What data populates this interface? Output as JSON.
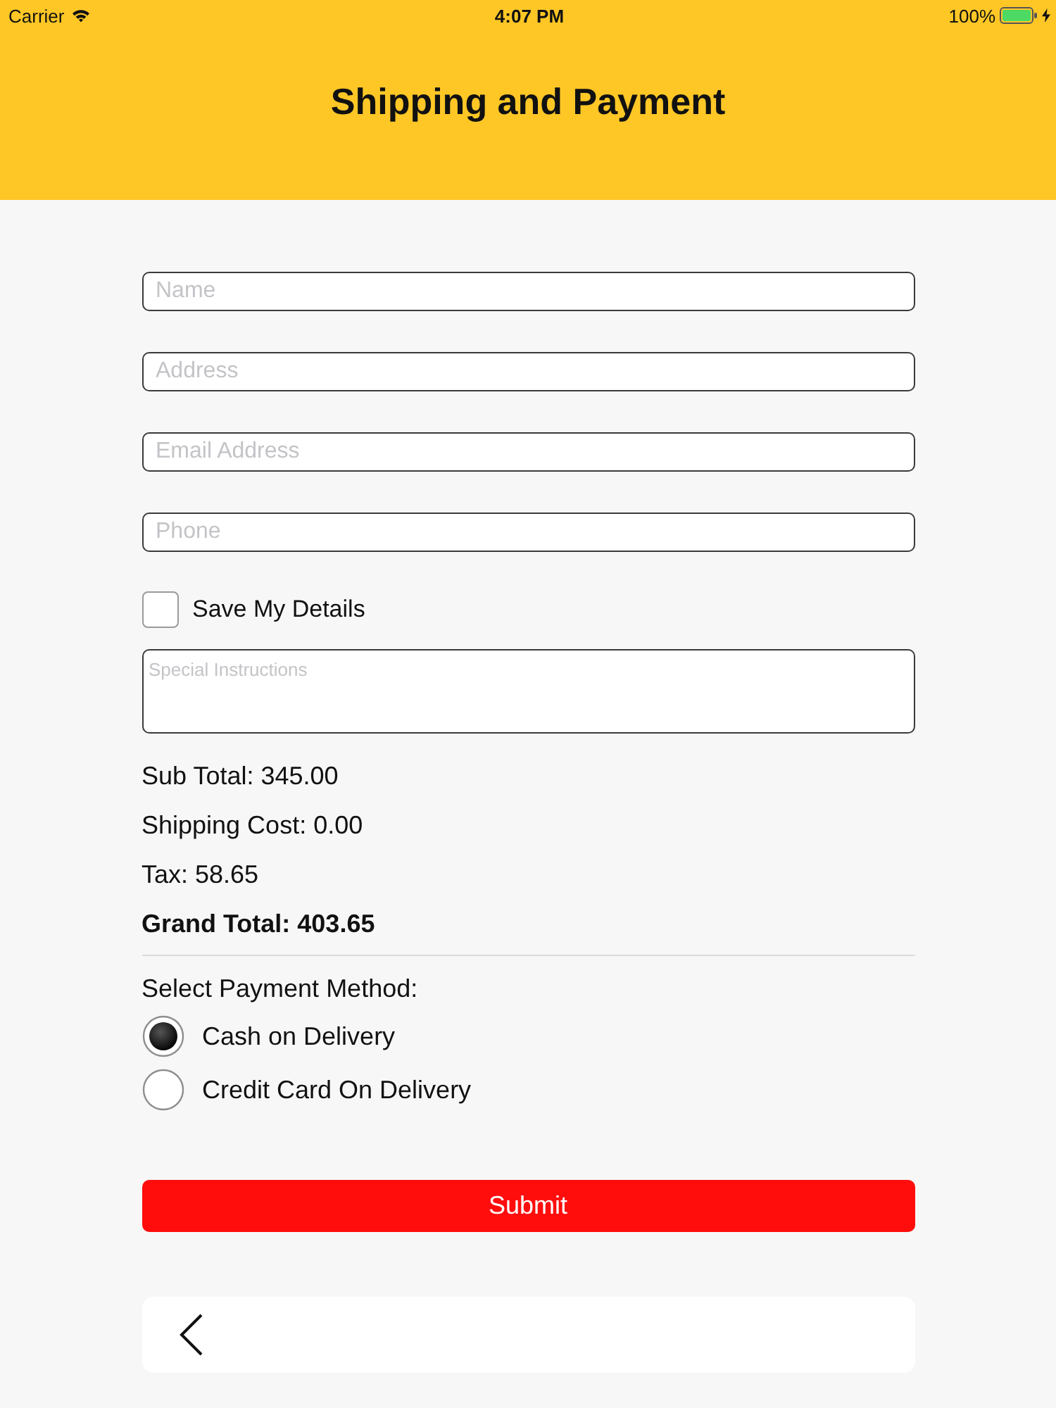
{
  "status_bar": {
    "carrier": "Carrier",
    "time": "4:07 PM",
    "battery": "100%"
  },
  "header": {
    "title": "Shipping and Payment"
  },
  "fields": [
    {
      "placeholder": "Name"
    },
    {
      "placeholder": "Address"
    },
    {
      "placeholder": "Email Address"
    },
    {
      "placeholder": "Phone"
    }
  ],
  "save_details": {
    "label": "Save My Details",
    "checked": false
  },
  "instructions": {
    "placeholder": "Special Instructions"
  },
  "summary": [
    {
      "kind": "line",
      "text": "Sub Total: 345.00"
    },
    {
      "kind": "line",
      "text": "Shipping Cost: 0.00"
    },
    {
      "kind": "line",
      "text": "Tax: 58.65"
    },
    {
      "kind": "total",
      "text": "Grand Total: 403.65"
    }
  ],
  "payment": {
    "label": "Select Payment Method:",
    "options": [
      {
        "label": "Cash on Delivery",
        "selected": true
      },
      {
        "label": "Credit Card On Delivery",
        "selected": false
      }
    ]
  },
  "submit": {
    "label": "Submit"
  }
}
